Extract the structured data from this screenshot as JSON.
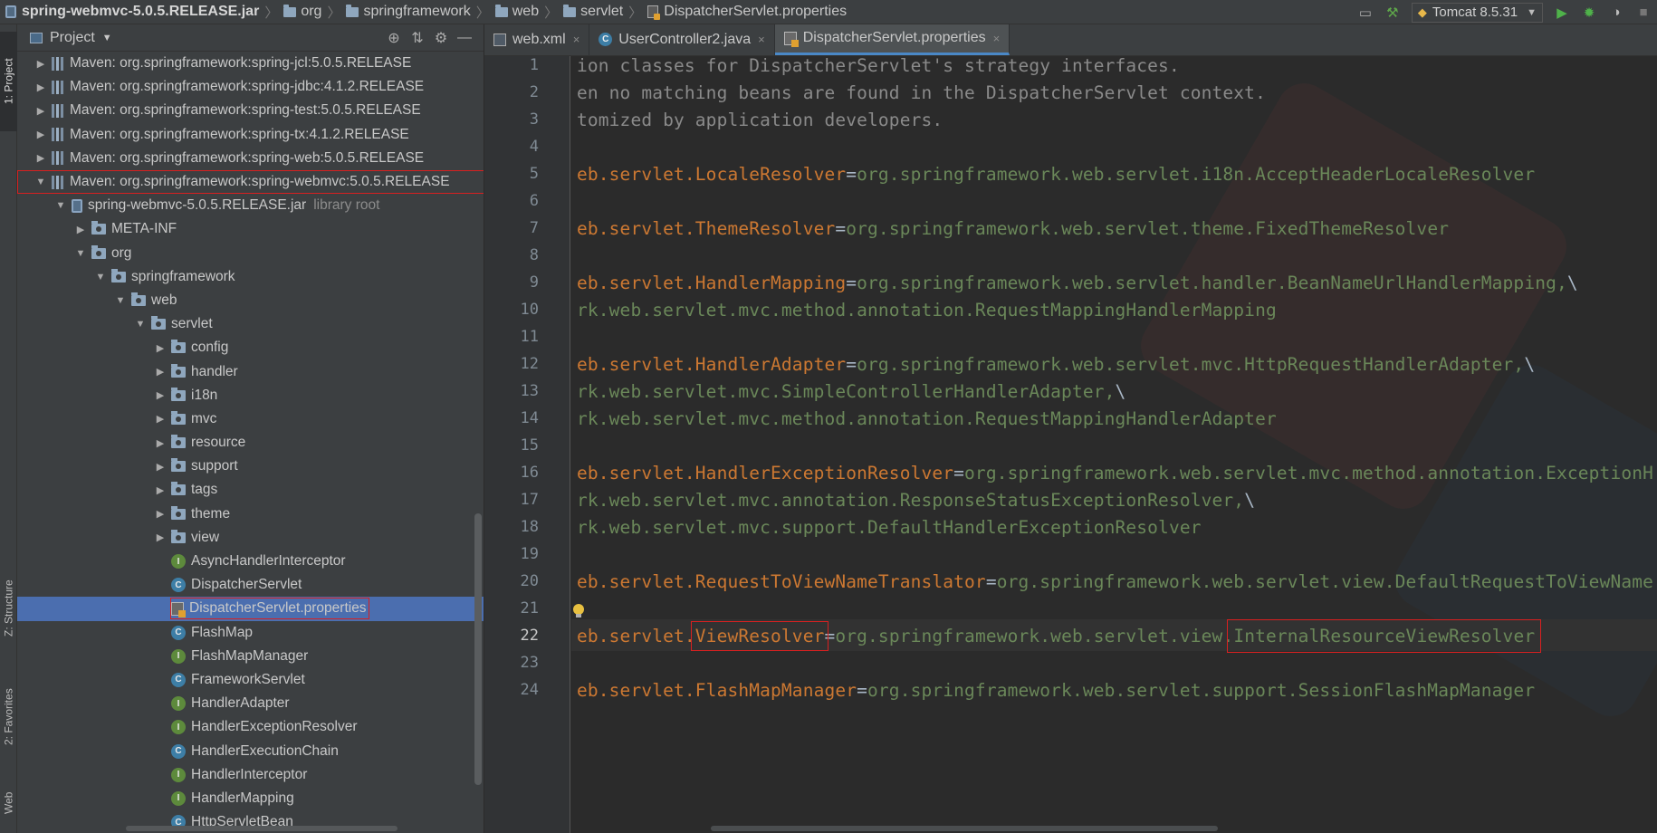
{
  "breadcrumbs": [
    {
      "label": "spring-webmvc-5.0.5.RELEASE.jar",
      "icon": "jar-icon"
    },
    {
      "label": "org",
      "icon": "package-icon"
    },
    {
      "label": "springframework",
      "icon": "package-icon"
    },
    {
      "label": "web",
      "icon": "package-icon"
    },
    {
      "label": "servlet",
      "icon": "package-icon"
    },
    {
      "label": "DispatcherServlet.properties",
      "icon": "properties-file-icon"
    }
  ],
  "run_config": {
    "label": "Tomcat 8.5.31"
  },
  "tool_stripe": {
    "project": "1: Project",
    "structure": "Z: Structure",
    "favorites": "2: Favorites",
    "web": "Web"
  },
  "project_panel": {
    "title": "Project",
    "tree": [
      {
        "label": "Maven: org.springframework:spring-jcl:5.0.5.RELEASE"
      },
      {
        "label": "Maven: org.springframework:spring-jdbc:4.1.2.RELEASE"
      },
      {
        "label": "Maven: org.springframework:spring-test:5.0.5.RELEASE"
      },
      {
        "label": "Maven: org.springframework:spring-tx:4.1.2.RELEASE"
      },
      {
        "label": "Maven: org.springframework:spring-web:5.0.5.RELEASE"
      },
      {
        "label": "Maven: org.springframework:spring-webmvc:5.0.5.RELEASE"
      },
      {
        "label": "spring-webmvc-5.0.5.RELEASE.jar",
        "suffix": "library root"
      },
      {
        "label": "META-INF"
      },
      {
        "label": "org"
      },
      {
        "label": "springframework"
      },
      {
        "label": "web"
      },
      {
        "label": "servlet"
      },
      {
        "label": "config"
      },
      {
        "label": "handler"
      },
      {
        "label": "i18n"
      },
      {
        "label": "mvc"
      },
      {
        "label": "resource"
      },
      {
        "label": "support"
      },
      {
        "label": "tags"
      },
      {
        "label": "theme"
      },
      {
        "label": "view"
      },
      {
        "label": "AsyncHandlerInterceptor"
      },
      {
        "label": "DispatcherServlet"
      },
      {
        "label": "DispatcherServlet.properties"
      },
      {
        "label": "FlashMap"
      },
      {
        "label": "FlashMapManager"
      },
      {
        "label": "FrameworkServlet"
      },
      {
        "label": "HandlerAdapter"
      },
      {
        "label": "HandlerExceptionResolver"
      },
      {
        "label": "HandlerExecutionChain"
      },
      {
        "label": "HandlerInterceptor"
      },
      {
        "label": "HandlerMapping"
      },
      {
        "label": "HttpServletBean"
      }
    ]
  },
  "editor": {
    "tabs": [
      {
        "label": "web.xml"
      },
      {
        "label": "UserController2.java"
      },
      {
        "label": "DispatcherServlet.properties"
      }
    ],
    "line_numbers": [
      "1",
      "2",
      "3",
      "4",
      "5",
      "6",
      "7",
      "8",
      "9",
      "10",
      "11",
      "12",
      "13",
      "14",
      "15",
      "16",
      "17",
      "18",
      "19",
      "20",
      "21",
      "22",
      "23",
      "24"
    ],
    "lines": {
      "l1": "ion classes for DispatcherServlet's strategy interfaces.",
      "l2": "en no matching beans are found in the DispatcherServlet context.",
      "l3": "tomized by application developers.",
      "l5k": "eb.servlet.LocaleResolver",
      "l5v": "org.springframework.web.servlet.i18n.AcceptHeaderLocaleResolver",
      "l7k": "eb.servlet.ThemeResolver",
      "l7v": "org.springframework.web.servlet.theme.FixedThemeResolver",
      "l9k": "eb.servlet.HandlerMapping",
      "l9v": "org.springframework.web.servlet.handler.BeanNameUrlHandlerMapping,",
      "l10": "rk.web.servlet.mvc.method.annotation.RequestMappingHandlerMapping",
      "l12k": "eb.servlet.HandlerAdapter",
      "l12v": "org.springframework.web.servlet.mvc.HttpRequestHandlerAdapter,",
      "l13": "rk.web.servlet.mvc.SimpleControllerHandlerAdapter,",
      "l14": "rk.web.servlet.mvc.method.annotation.RequestMappingHandlerAdapter",
      "l16k": "eb.servlet.HandlerExceptionResolver",
      "l16v": "org.springframework.web.servlet.mvc.method.annotation.ExceptionH",
      "l17": "rk.web.servlet.mvc.annotation.ResponseStatusExceptionResolver,",
      "l18": "rk.web.servlet.mvc.support.DefaultHandlerExceptionResolver",
      "l20k": "eb.servlet.RequestToViewNameTranslator",
      "l20v": "org.springframework.web.servlet.view.DefaultRequestToViewName",
      "l22k1": "eb.servlet.",
      "l22k2": "ViewResolver",
      "l22v1": "org.springframework.web.servlet.view.",
      "l22v2": "InternalResourceViewResolver",
      "l24k": "eb.servlet.FlashMapManager",
      "l24v": "org.springframework.web.servlet.support.SessionFlashMapManager",
      "eq": "=",
      "cont": "\\"
    }
  },
  "colors": {
    "key": "#cc7832",
    "value": "#6a8759",
    "selection": "#4b6eaf",
    "highlight": "#d82020"
  }
}
